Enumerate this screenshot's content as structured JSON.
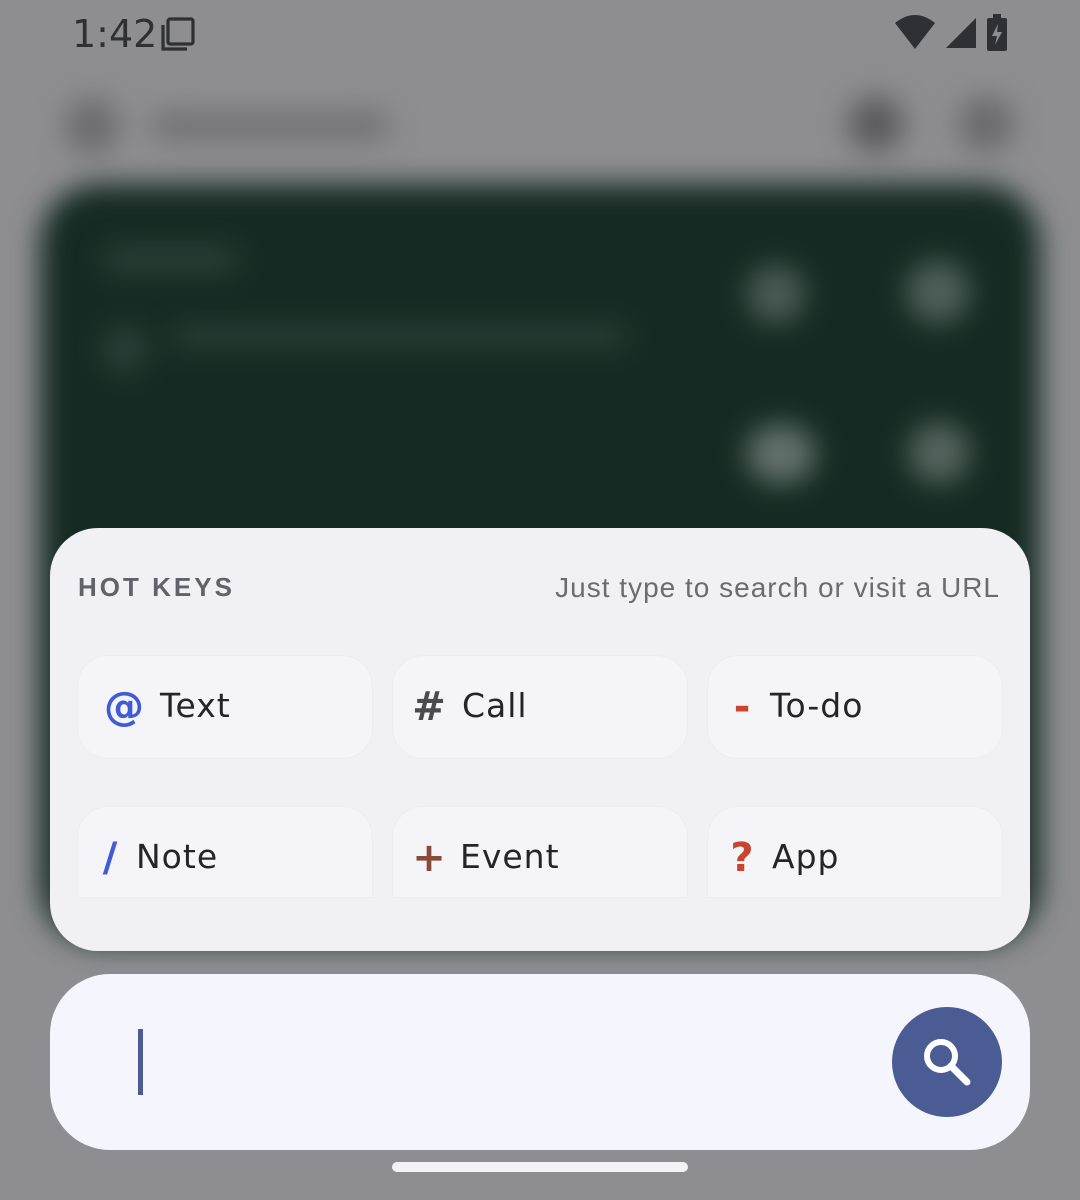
{
  "status_bar": {
    "time": "1:42",
    "icons": [
      "screen-record-icon",
      "wifi-icon",
      "cell-signal-icon",
      "battery-charging-icon"
    ]
  },
  "hot_keys": {
    "title": "HOT KEYS",
    "hint": "Just type to search or visit a URL",
    "keys": [
      {
        "symbol": "@",
        "label": "Text",
        "color": "#3f5bd6"
      },
      {
        "symbol": "#",
        "label": "Call",
        "color": "#4a4a4f"
      },
      {
        "symbol": "-",
        "label": "To-do",
        "color": "#c9442f"
      },
      {
        "symbol": "/",
        "label": "Note",
        "color": "#3f5bd6"
      },
      {
        "symbol": "+",
        "label": "Event",
        "color": "#8a4a3a"
      },
      {
        "symbol": "?",
        "label": "App",
        "color": "#c9442f"
      }
    ]
  },
  "search": {
    "value": "",
    "button_icon": "search-icon",
    "accent": "#4b5b93"
  }
}
